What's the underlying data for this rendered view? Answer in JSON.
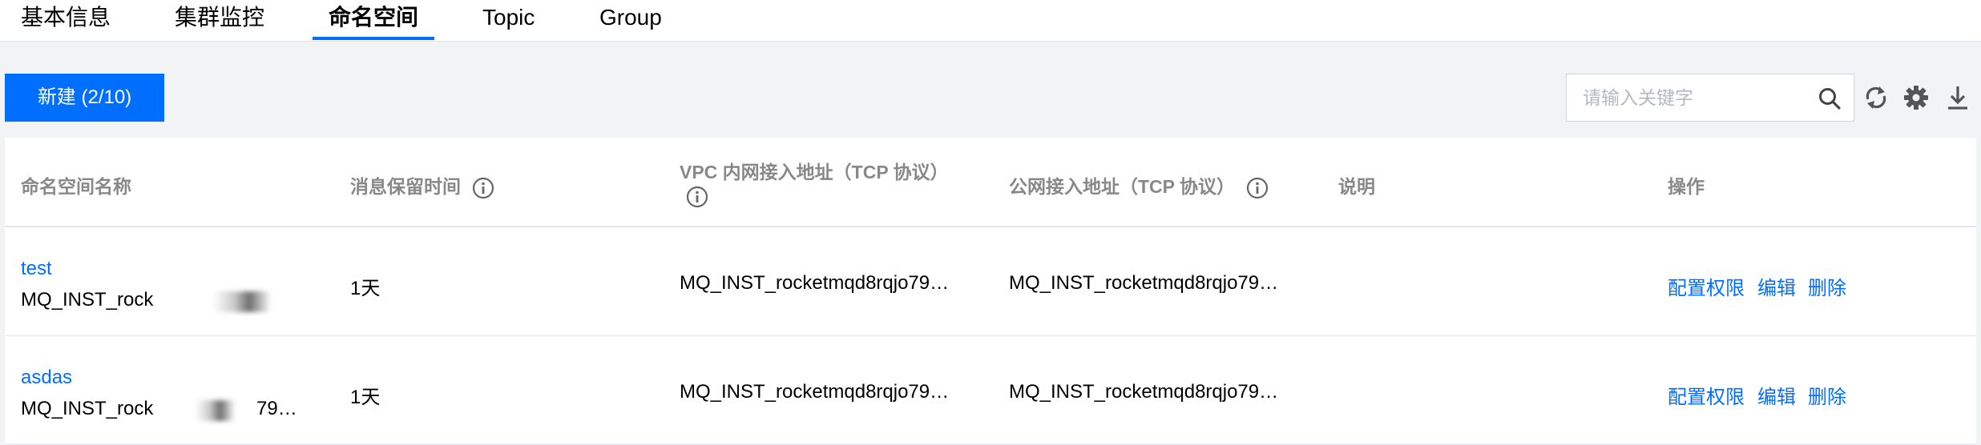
{
  "tabs": [
    {
      "label": "基本信息"
    },
    {
      "label": "集群监控"
    },
    {
      "label": "命名空间"
    },
    {
      "label": "Topic"
    },
    {
      "label": "Group"
    }
  ],
  "toolbar": {
    "new_button_label": "新建 (2/10)",
    "search_placeholder": "请输入关键字",
    "search_value": ""
  },
  "table": {
    "columns": [
      {
        "label": "命名空间名称",
        "has_info": false
      },
      {
        "label": "消息保留时间",
        "has_info": true
      },
      {
        "label": "VPC 内网接入地址（TCP 协议）",
        "has_info": true
      },
      {
        "label": "公网接入地址（TCP 协议）",
        "has_info": true
      },
      {
        "label": "说明",
        "has_info": false
      },
      {
        "label": "操作",
        "has_info": false
      }
    ],
    "rows": [
      {
        "name": "test",
        "id_visible": "MQ_INST_rock",
        "id_tail": "",
        "retention": "1天",
        "vpc_address": "MQ_INST_rocketmqd8rqjo79…",
        "public_address": "MQ_INST_rocketmqd8rqjo79…",
        "description": "",
        "actions": [
          "配置权限",
          "编辑",
          "删除"
        ]
      },
      {
        "name": "asdas",
        "id_visible": "MQ_INST_rock",
        "id_tail": "79…",
        "retention": "1天",
        "vpc_address": "MQ_INST_rocketmqd8rqjo79…",
        "public_address": "MQ_INST_rocketmqd8rqjo79…",
        "description": "",
        "actions": [
          "配置权限",
          "编辑",
          "删除"
        ]
      }
    ]
  },
  "colors": {
    "accent": "#006eff",
    "header_text": "#888888",
    "background": "#f2f3f5"
  },
  "icons": [
    "search-icon",
    "refresh-icon",
    "settings-icon",
    "download-icon",
    "info-icon"
  ]
}
